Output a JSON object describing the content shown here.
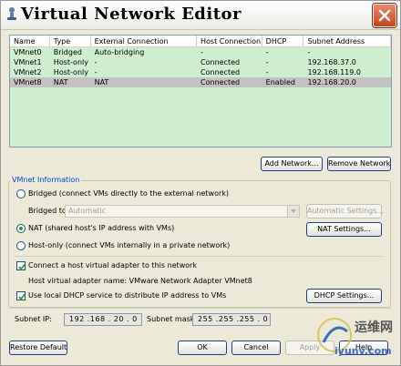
{
  "window": {
    "title": "Virtual Network Editor"
  },
  "table": {
    "columns": [
      "Name",
      "Type",
      "External Connection",
      "Host Connection",
      "DHCP",
      "Subnet Address"
    ],
    "rows": [
      [
        "VMnet0",
        "Bridged",
        "Auto-bridging",
        "-",
        "-",
        "-"
      ],
      [
        "VMnet1",
        "Host-only",
        "-",
        "Connected",
        "-",
        "192.168.37.0"
      ],
      [
        "VMnet2",
        "Host-only",
        "-",
        "Connected",
        "-",
        "192.168.119.0"
      ],
      [
        "VMnet8",
        "NAT",
        "NAT",
        "Connected",
        "Enabled",
        "192.168.20.0"
      ]
    ],
    "selected_row": 3
  },
  "buttons": {
    "add_network": "Add Network...",
    "remove_network": "Remove Network",
    "automatic_settings": "Automatic Settings...",
    "nat_settings": "NAT Settings...",
    "dhcp_settings": "DHCP Settings...",
    "restore_default": "Restore Default",
    "ok": "OK",
    "cancel": "Cancel",
    "apply": "Apply",
    "help": "Help"
  },
  "vmnet_info": {
    "title": "VMnet Information",
    "bridged_label": "Bridged (connect VMs directly to the external network)",
    "bridged_to_label": "Bridged to:",
    "bridged_to_value": "Automatic",
    "nat_label": "NAT (shared host's IP address with VMs)",
    "hostonly_label": "Host-only (connect VMs internally in a private network)",
    "selected_mode": "nat",
    "connect_adapter_label": "Connect a host virtual adapter to this network",
    "connect_adapter_checked": true,
    "adapter_name_text": "Host virtual adapter name: VMware Network Adapter VMnet8",
    "dhcp_label": "Use local DHCP service to distribute IP address to VMs",
    "dhcp_checked": true,
    "subnet_ip_label": "Subnet IP:",
    "subnet_ip_value": "192 .168 . 20  .  0",
    "subnet_mask_label": "Subnet mask:",
    "subnet_mask_value": "255 .255 .255 .  0"
  },
  "watermark": {
    "text_cn": "运维网",
    "url": "iyunv.com"
  },
  "colors": {
    "table_bg": "#cfeecf",
    "selected_row": "#c2c2c2",
    "group_title": "#0046d5"
  }
}
